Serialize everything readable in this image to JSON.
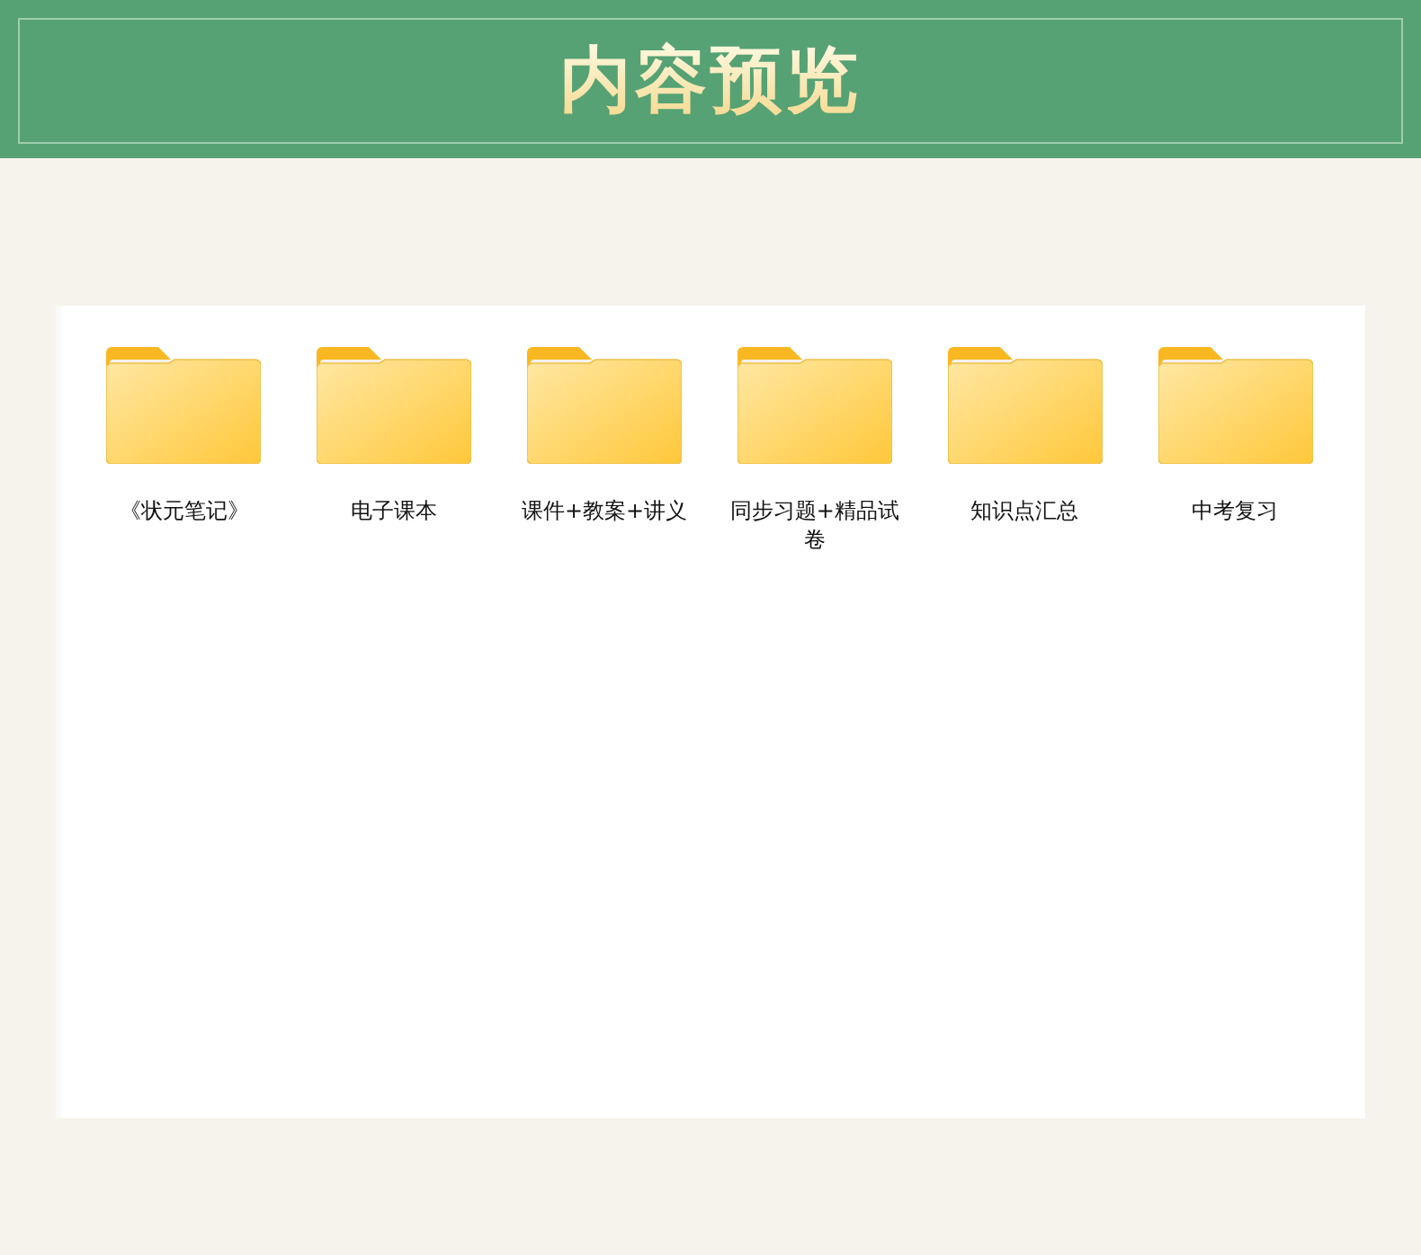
{
  "header": {
    "title": "内容预览"
  },
  "folders": [
    {
      "name": "《状元笔记》"
    },
    {
      "name": "电子课本"
    },
    {
      "name": "课件+教案+讲义"
    },
    {
      "name": "同步习题+精品试卷"
    },
    {
      "name": "知识点汇总"
    },
    {
      "name": "中考复习"
    }
  ]
}
